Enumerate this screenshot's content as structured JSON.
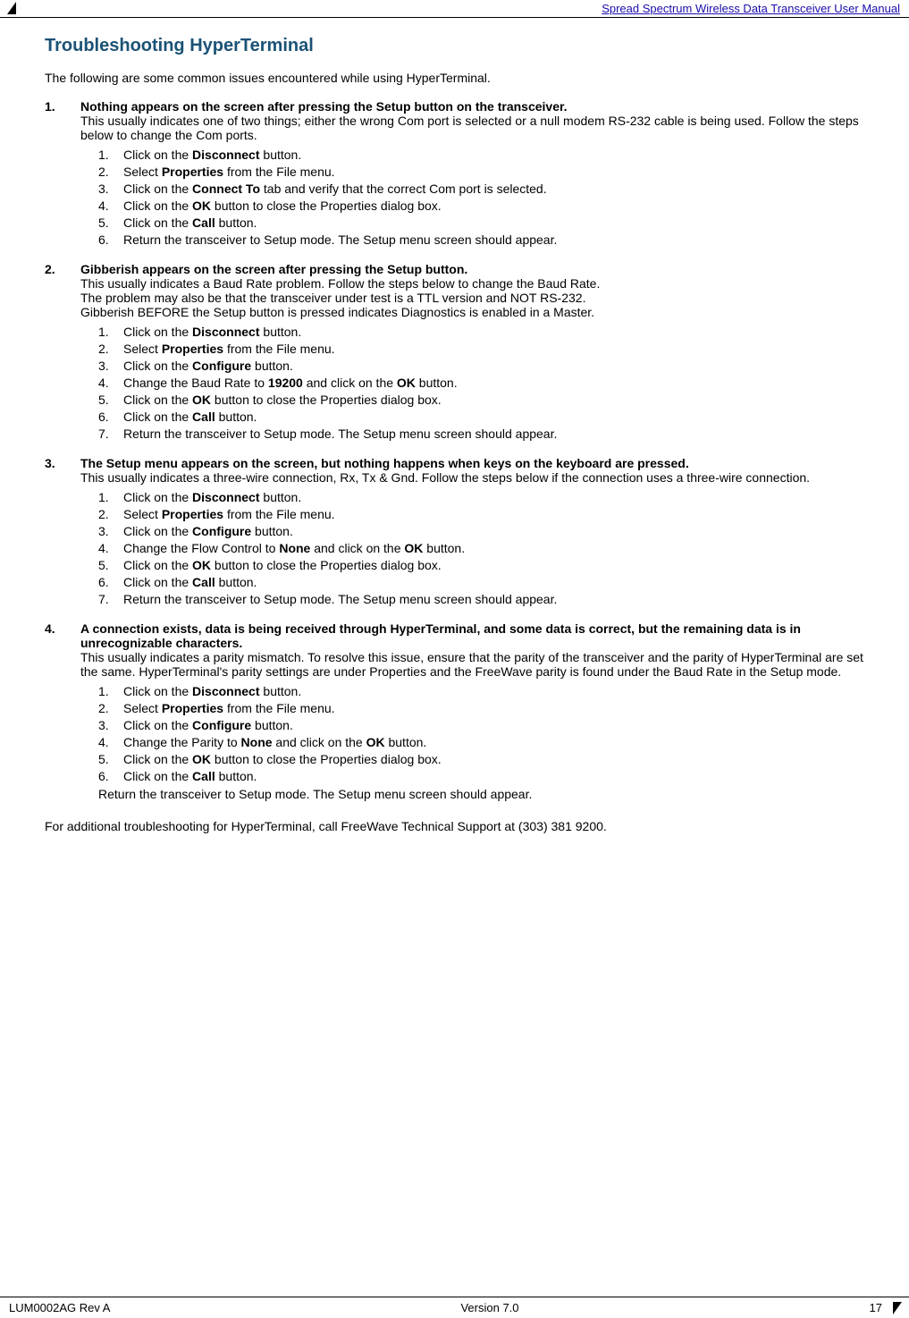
{
  "header": {
    "title": "Spread Spectrum Wireless Data Transceiver User Manual",
    "triangle_left": "◄"
  },
  "footer": {
    "left": "LUM0002AG Rev A",
    "center": "Version 7.0",
    "right": "17"
  },
  "page": {
    "title": "Troubleshooting HyperTerminal",
    "intro": "The following are some common issues encountered while using HyperTerminal.",
    "items": [
      {
        "num": "1.",
        "heading": "Nothing appears on the screen after pressing the Setup button on the transceiver.",
        "body": "This usually indicates one of two things; either the wrong Com port is selected or a null modem RS-232 cable is being used. Follow the steps below to change the Com ports.",
        "steps": [
          {
            "num": "1.",
            "text_pre": "Click on the ",
            "bold": "Disconnect",
            "text_post": " button."
          },
          {
            "num": "2.",
            "text_pre": "Select ",
            "bold": "Properties",
            "text_post": " from the File menu."
          },
          {
            "num": "3.",
            "text_pre": "Click on the ",
            "bold": "Connect To",
            "text_post": " tab and verify that the correct Com port is selected."
          },
          {
            "num": "4.",
            "text_pre": "Click on the ",
            "bold": "OK",
            "text_post": " button to close the Properties dialog box."
          },
          {
            "num": "5.",
            "text_pre": "Click on the ",
            "bold": "Call",
            "text_post": " button."
          },
          {
            "num": "6.",
            "text_pre": "",
            "bold": "",
            "text_post": "Return the transceiver to Setup mode. The Setup menu screen should appear."
          }
        ]
      },
      {
        "num": "2.",
        "heading": "Gibberish appears on the screen after pressing the Setup button.",
        "body": "This usually indicates a Baud Rate problem. Follow the steps below to change the Baud Rate.\nThe problem may also be that the transceiver under test is a TTL version and NOT RS-232.\nGibberish BEFORE the Setup button is pressed indicates Diagnostics is enabled in a Master.",
        "steps": [
          {
            "num": "1.",
            "text_pre": "Click on the ",
            "bold": "Disconnect",
            "text_post": " button."
          },
          {
            "num": "2.",
            "text_pre": "Select ",
            "bold": "Properties",
            "text_post": " from the File menu."
          },
          {
            "num": "3.",
            "text_pre": "Click on the ",
            "bold": "Configure",
            "text_post": " button."
          },
          {
            "num": "4.",
            "text_pre": "Change the Baud Rate to ",
            "bold": "19200",
            "text_post": " and click on the ",
            "bold2": "OK",
            "text_post2": " button."
          },
          {
            "num": "5.",
            "text_pre": "Click on the ",
            "bold": "OK",
            "text_post": " button to close the Properties dialog box."
          },
          {
            "num": "6.",
            "text_pre": "Click on the ",
            "bold": "Call",
            "text_post": " button."
          },
          {
            "num": "7.",
            "text_pre": "",
            "bold": "",
            "text_post": "Return the transceiver to Setup mode. The Setup menu screen should appear."
          }
        ]
      },
      {
        "num": "3.",
        "heading": "The Setup menu appears on the screen, but nothing happens when keys on the keyboard are pressed.",
        "body": "This usually indicates a three-wire connection, Rx, Tx & Gnd. Follow the steps below if the connection uses a three-wire connection.",
        "steps": [
          {
            "num": "1.",
            "text_pre": "Click on the ",
            "bold": "Disconnect",
            "text_post": " button."
          },
          {
            "num": "2.",
            "text_pre": "Select ",
            "bold": "Properties",
            "text_post": " from the File menu."
          },
          {
            "num": "3.",
            "text_pre": "Click on the ",
            "bold": "Configure",
            "text_post": " button."
          },
          {
            "num": "4.",
            "text_pre": "Change the Flow Control to ",
            "bold": "None",
            "text_post": " and click on the ",
            "bold2": "OK",
            "text_post2": " button."
          },
          {
            "num": "5.",
            "text_pre": "Click on the ",
            "bold": "OK",
            "text_post": " button to close the Properties dialog box."
          },
          {
            "num": "6.",
            "text_pre": "Click on the ",
            "bold": "Call",
            "text_post": " button."
          },
          {
            "num": "7.",
            "text_pre": "",
            "bold": "",
            "text_post": "Return the transceiver to Setup mode. The Setup menu screen should appear."
          }
        ]
      },
      {
        "num": "4.",
        "heading": "A connection exists, data is being received through HyperTerminal, and some data is correct, but the remaining data is in unrecognizable characters.",
        "body": "This usually indicates a parity mismatch. To resolve this issue, ensure that the parity of the transceiver and the parity of HyperTerminal are set the same. HyperTerminal's parity settings are under Properties and the FreeWave parity is found under the Baud Rate in the Setup mode.",
        "steps": [
          {
            "num": "1.",
            "text_pre": "Click on the ",
            "bold": "Disconnect",
            "text_post": " button."
          },
          {
            "num": "2.",
            "text_pre": "Select ",
            "bold": "Properties",
            "text_post": " from the File menu."
          },
          {
            "num": "3.",
            "text_pre": "Click on the ",
            "bold": "Configure",
            "text_post": " button."
          },
          {
            "num": "4.",
            "text_pre": "Change the Parity to ",
            "bold": "None",
            "text_post": " and click on the ",
            "bold2": "OK",
            "text_post2": " button."
          },
          {
            "num": "5.",
            "text_pre": "Click on the ",
            "bold": "OK",
            "text_post": " button to close the Properties dialog box."
          },
          {
            "num": "6.",
            "text_pre": "Click on the ",
            "bold": "Call",
            "text_post": " button."
          }
        ],
        "after_steps": "Return the transceiver to Setup mode. The Setup menu screen should appear."
      }
    ],
    "additional": "For additional troubleshooting for HyperTerminal, call FreeWave Technical Support at (303) 381 9200."
  }
}
